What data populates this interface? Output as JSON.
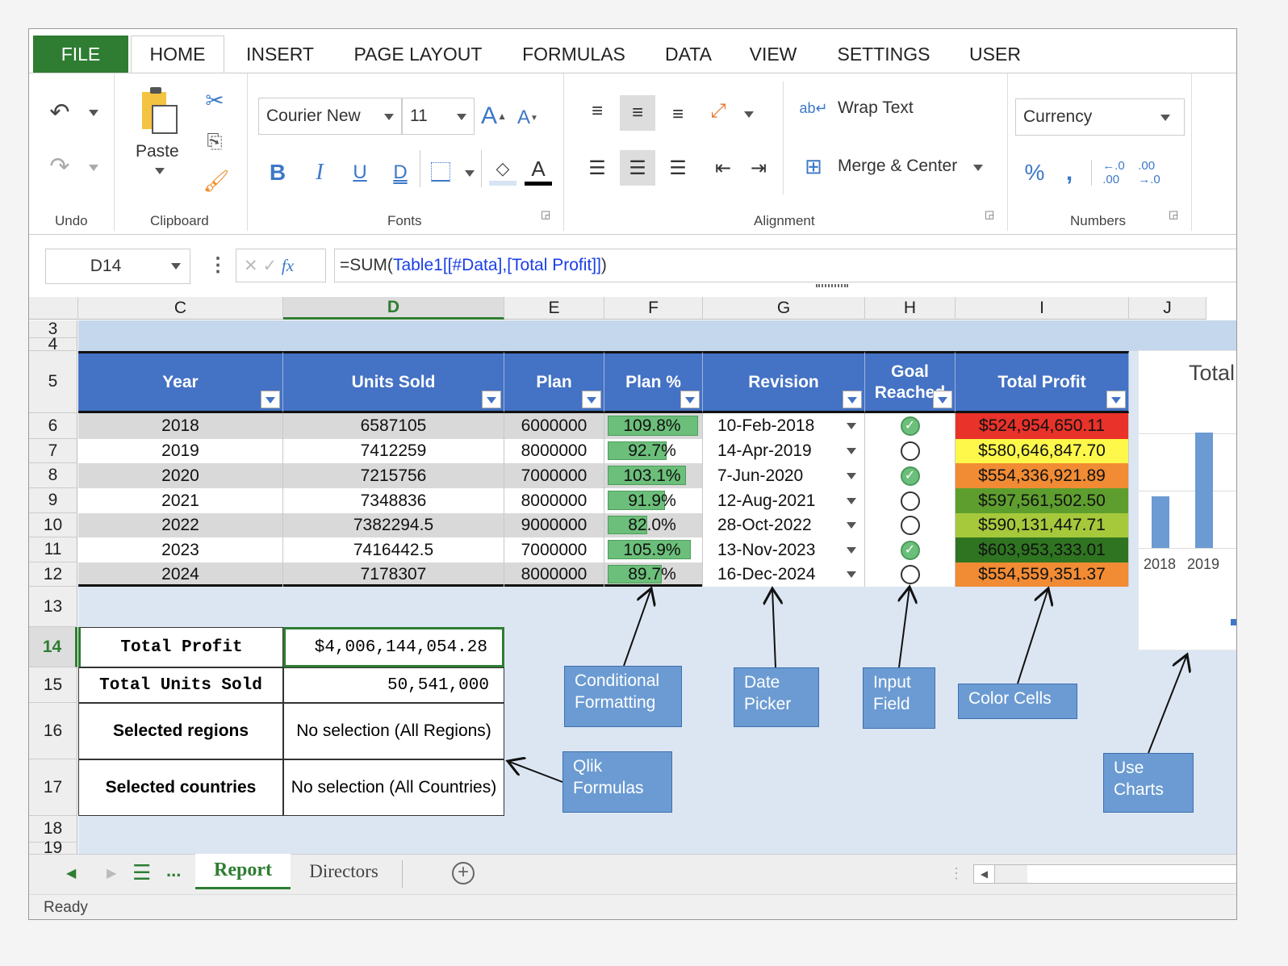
{
  "ribbon": {
    "tabs": [
      "FILE",
      "HOME",
      "INSERT",
      "PAGE LAYOUT",
      "FORMULAS",
      "DATA",
      "VIEW",
      "SETTINGS",
      "USER"
    ],
    "active_tab": "HOME",
    "groups": {
      "undo": "Undo",
      "clipboard": "Clipboard",
      "fonts": "Fonts",
      "alignment": "Alignment",
      "numbers": "Numbers"
    },
    "paste": "Paste",
    "font_name": "Courier New",
    "font_size": "11",
    "wrap_text": "Wrap Text",
    "merge_center": "Merge & Center",
    "number_format": "Currency",
    "accent": "#2e7d32"
  },
  "formula_bar": {
    "name_box": "D14",
    "fx": "fx",
    "formula_prefix": "=SUM(",
    "formula_ref": "Table1[[#Data],[Total Profit]]",
    "formula_suffix": ")"
  },
  "columns": [
    "C",
    "D",
    "E",
    "F",
    "G",
    "H",
    "I",
    "J"
  ],
  "active_column": "D",
  "rows": [
    "3",
    "4",
    "5",
    "6",
    "7",
    "8",
    "9",
    "10",
    "11",
    "12",
    "13",
    "14",
    "15",
    "16",
    "17",
    "18",
    "19"
  ],
  "active_row": "14",
  "table": {
    "headers": [
      "Year",
      "Units Sold",
      "Plan",
      "Plan %",
      "Revision",
      "Goal Reached",
      "Total Profit"
    ],
    "data": [
      {
        "year": "2018",
        "units": "6587105",
        "plan": "6000000",
        "pct": "109.8%",
        "pct_value": 109.8,
        "revision": "10-Feb-2018",
        "goal": true,
        "profit": "$524,954,650.11",
        "color": "#e8322a"
      },
      {
        "year": "2019",
        "units": "7412259",
        "plan": "8000000",
        "pct": "92.7%",
        "pct_value": 92.7,
        "revision": "14-Apr-2019",
        "goal": false,
        "profit": "$580,646,847.70",
        "color": "#fdf84a"
      },
      {
        "year": "2020",
        "units": "7215756",
        "plan": "7000000",
        "pct": "103.1%",
        "pct_value": 103.1,
        "revision": "7-Jun-2020",
        "goal": true,
        "profit": "$554,336,921.89",
        "color": "#f18b34"
      },
      {
        "year": "2021",
        "units": "7348836",
        "plan": "8000000",
        "pct": "91.9%",
        "pct_value": 91.9,
        "revision": "12-Aug-2021",
        "goal": false,
        "profit": "$597,561,502.50",
        "color": "#5e9e2e"
      },
      {
        "year": "2022",
        "units": "7382294.5",
        "plan": "9000000",
        "pct": "82.0%",
        "pct_value": 82.0,
        "revision": "28-Oct-2022",
        "goal": false,
        "profit": "$590,131,447.71",
        "color": "#a6c93b"
      },
      {
        "year": "2023",
        "units": "7416442.5",
        "plan": "7000000",
        "pct": "105.9%",
        "pct_value": 105.9,
        "revision": "13-Nov-2023",
        "goal": true,
        "profit": "$603,953,333.01",
        "color": "#2f7421"
      },
      {
        "year": "2024",
        "units": "7178307",
        "plan": "8000000",
        "pct": "89.7%",
        "pct_value": 89.7,
        "revision": "16-Dec-2024",
        "goal": false,
        "profit": "$554,559,351.37",
        "color": "#f18b34"
      }
    ]
  },
  "summary": [
    {
      "label": "Total Profit",
      "value": "$4,006,144,054.28"
    },
    {
      "label": "Total Units Sold",
      "value": "50,541,000"
    },
    {
      "label": "Selected regions",
      "value": "No selection (All Regions)"
    },
    {
      "label": "Selected countries",
      "value": "No selection (All Countries)"
    }
  ],
  "annotations": {
    "cond": "Conditional Formatting",
    "date": "Date Picker",
    "input": "Input Field",
    "color": "Color Cells",
    "qlik": "Qlik Formulas",
    "charts": "Use Charts"
  },
  "chart_data": {
    "type": "bar",
    "title": "Total",
    "categories": [
      "2018",
      "2019"
    ],
    "values": [
      524954650.11,
      580646847.7
    ],
    "ylim": [
      480000000,
      580000000
    ],
    "grid": true,
    "bar_color": "#6b9bd2"
  },
  "sheets": {
    "tabs": [
      "Report",
      "Directors"
    ],
    "active": "Report",
    "more": "..."
  },
  "status": "Ready"
}
